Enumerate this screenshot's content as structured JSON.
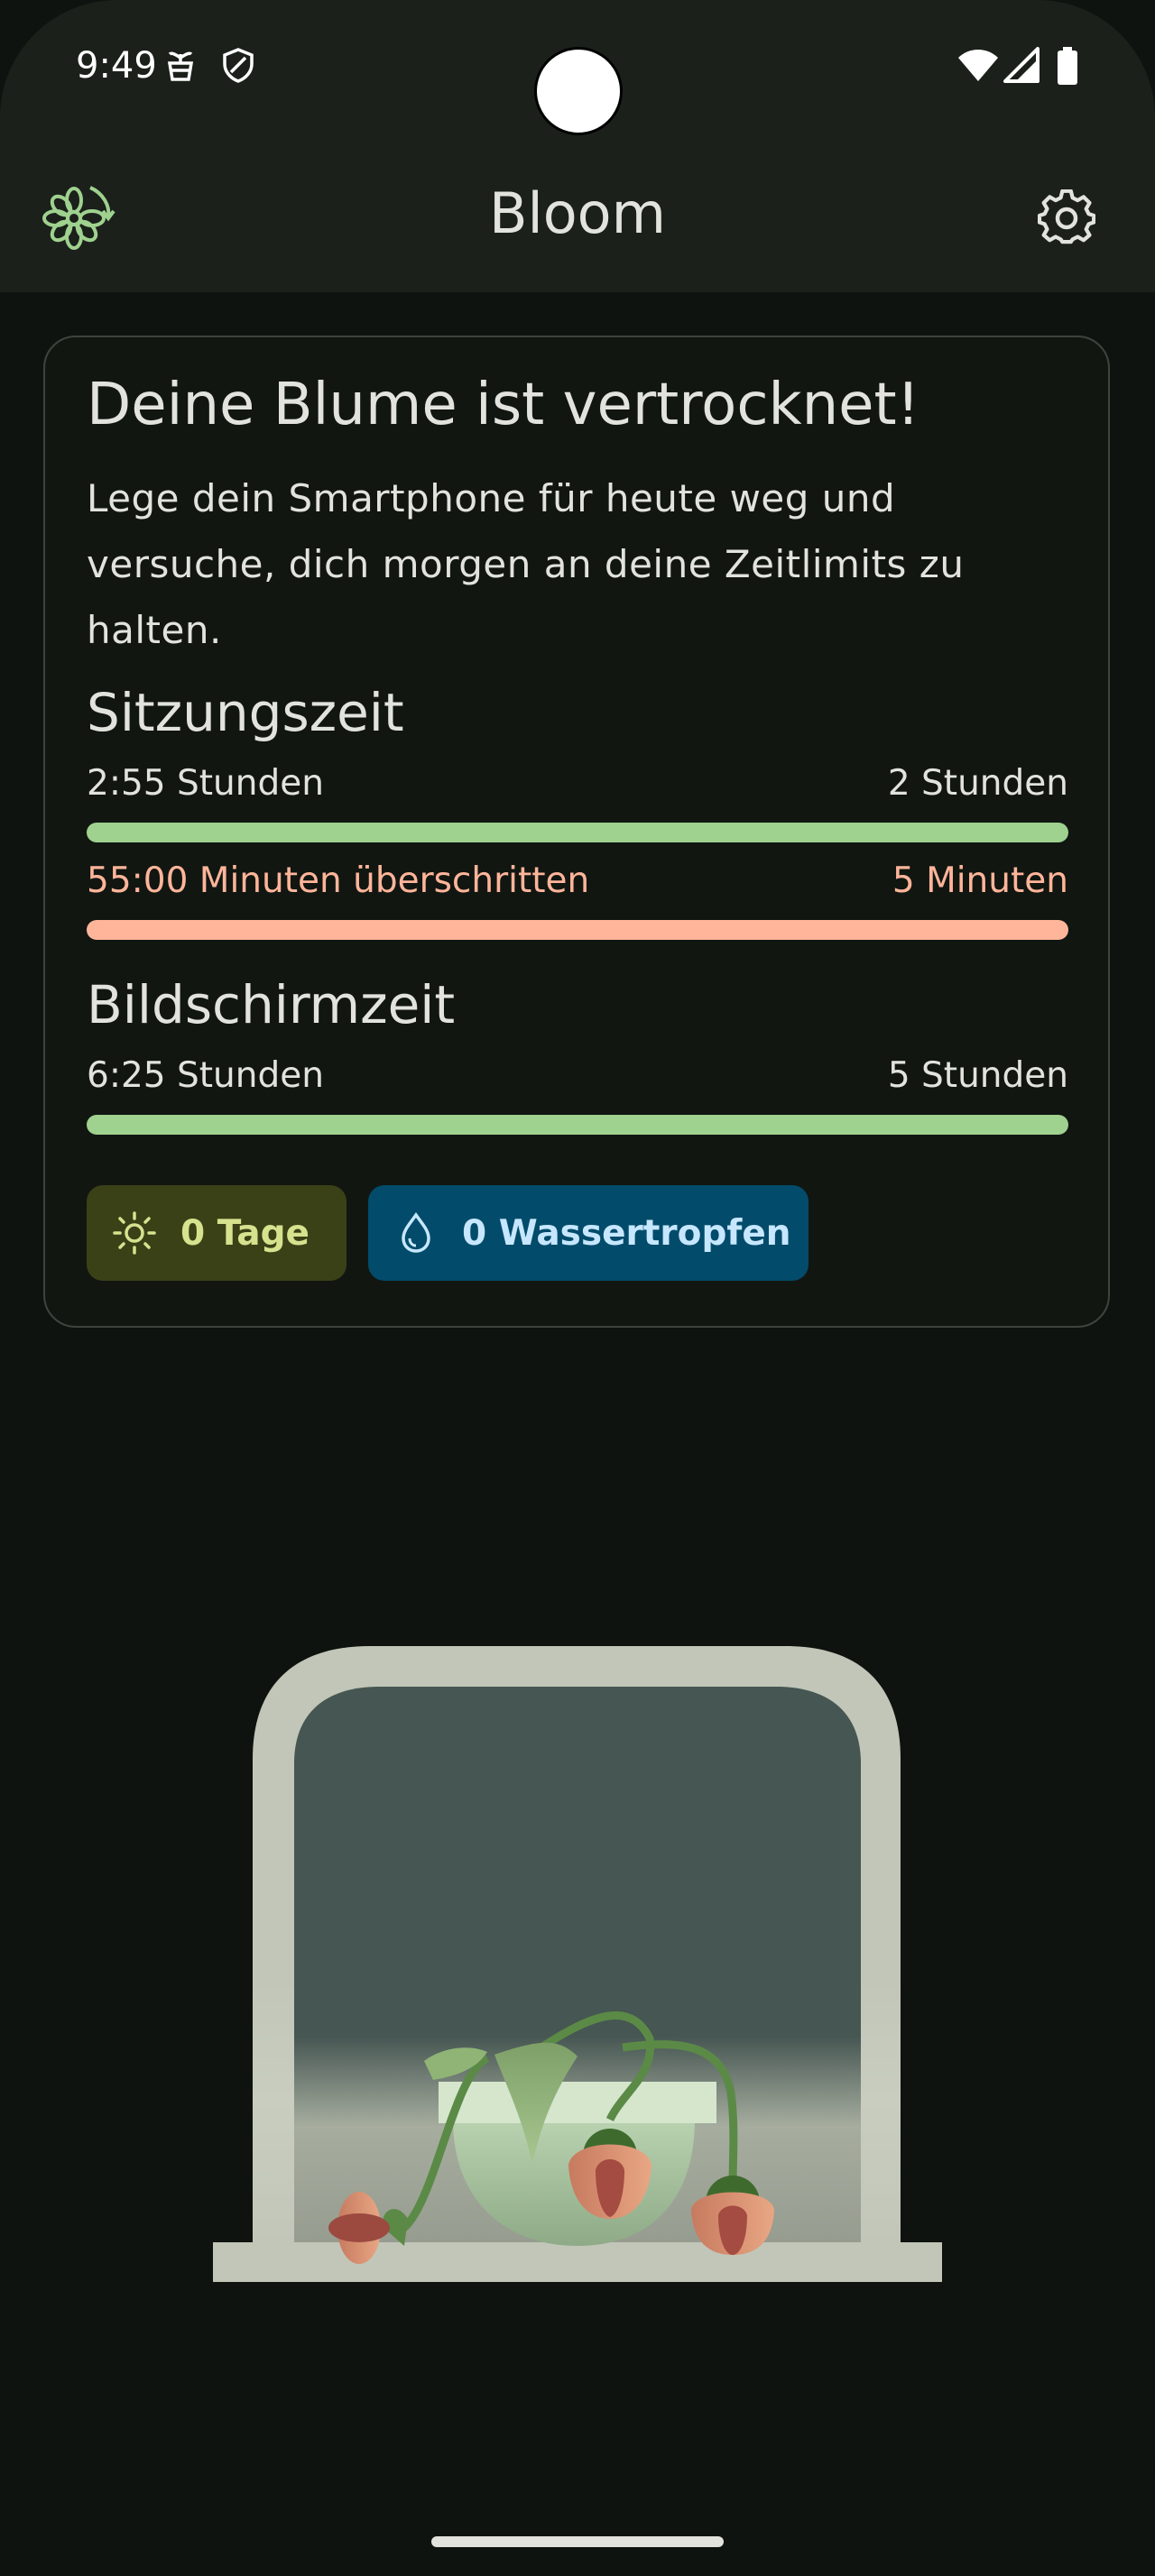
{
  "status_bar": {
    "time": "9:49"
  },
  "app_bar": {
    "title": "Bloom"
  },
  "card": {
    "headline": "Deine Blume ist vertrocknet!",
    "body_lines": [
      "Lege dein Smartphone für heute weg und",
      "versuche, dich morgen an deine Zeitlimits zu",
      "halten."
    ],
    "session": {
      "title": "Sitzungszeit",
      "used": "2:55 Stunden",
      "limit": "2 Stunden",
      "used_progress": 1.0,
      "exceeded": "55:00 Minuten überschritten",
      "exceeded_limit": "5 Minuten",
      "exceeded_progress": 1.0
    },
    "screen": {
      "title": "Bildschirmzeit",
      "used": "6:25 Stunden",
      "limit": "5 Stunden",
      "used_progress": 1.0
    },
    "chips": {
      "days": "0 Tage",
      "days_icon": "sun-icon",
      "water": "0 Wassertropfen",
      "water_icon": "water-drop-icon"
    }
  },
  "colors": {
    "background": "#0f130f",
    "progress_ok": "#9fd18f",
    "progress_exceeded": "#ffb59a",
    "chip_days": "#3a4117",
    "chip_water": "#034b6a"
  }
}
